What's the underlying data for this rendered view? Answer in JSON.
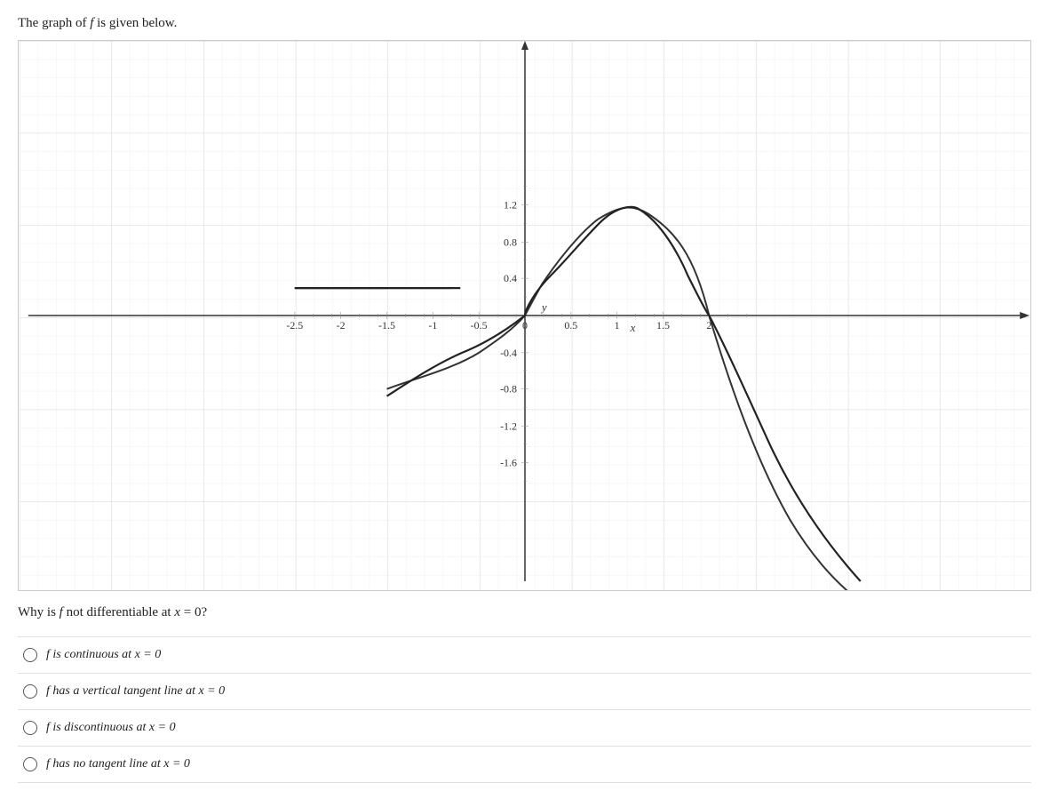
{
  "intro": {
    "prefix": "The graph of ",
    "func": "f",
    "suffix": " is given below."
  },
  "question": {
    "text_prefix": "Why is ",
    "func": "f",
    "text_middle": " not differentiable at ",
    "var": "x",
    "equals": " = 0?"
  },
  "options": [
    {
      "id": "opt1",
      "label_prefix": "f",
      "label_middle": " is continuous at ",
      "label_var": "x",
      "label_eq": " = 0"
    },
    {
      "id": "opt2",
      "label_prefix": "f",
      "label_middle": " has a vertical tangent line at ",
      "label_var": "x",
      "label_eq": " = 0"
    },
    {
      "id": "opt3",
      "label_prefix": "f",
      "label_middle": " is discontinuous at ",
      "label_var": "x",
      "label_eq": " = 0"
    },
    {
      "id": "opt4",
      "label_prefix": "f",
      "label_middle": " has no tangent line at ",
      "label_var": "x",
      "label_eq": " = 0"
    }
  ],
  "graph": {
    "x_labels": [
      "-2.5",
      "-2",
      "-1.5",
      "-1",
      "-0.5",
      "0",
      "0.5",
      "1",
      "1.5",
      "2"
    ],
    "y_labels": [
      "-1.6",
      "-1.2",
      "-0.8",
      "-0.4",
      "0.4",
      "0.8",
      "1.2"
    ],
    "axis_x": "x",
    "axis_y": "y"
  }
}
